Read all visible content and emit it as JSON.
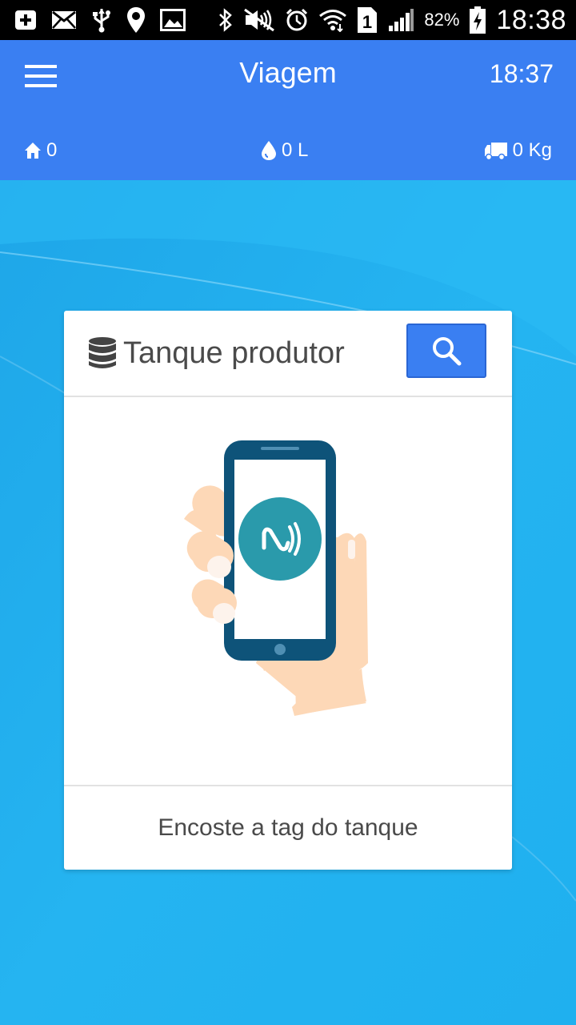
{
  "status_bar": {
    "icons": [
      "add-notification-icon",
      "mail-icon",
      "usb-icon",
      "location-icon",
      "image-icon",
      "bluetooth-icon",
      "mute-icon",
      "alarm-icon",
      "wifi-icon",
      "sim-icon",
      "signal-icon",
      "battery-charging-icon"
    ],
    "sim_label": "1",
    "battery_percent": "82%",
    "time": "18:38"
  },
  "app_bar": {
    "title": "Viagem",
    "clock": "18:37",
    "color": "#3a7ff2"
  },
  "stats": {
    "home_count": "0",
    "volume": "0 L",
    "weight": "0 Kg"
  },
  "card": {
    "title": "Tanque produtor",
    "title_icon": "database-icon",
    "search_icon": "search-icon",
    "hint": "Encoste a tag do tanque",
    "illustration": "hand-holding-phone-nfc"
  },
  "colors": {
    "background": "#1fb0ef",
    "accent": "#3a7ff2",
    "nfc_circle": "#2a9aab",
    "phone_frame": "#0e5379"
  }
}
